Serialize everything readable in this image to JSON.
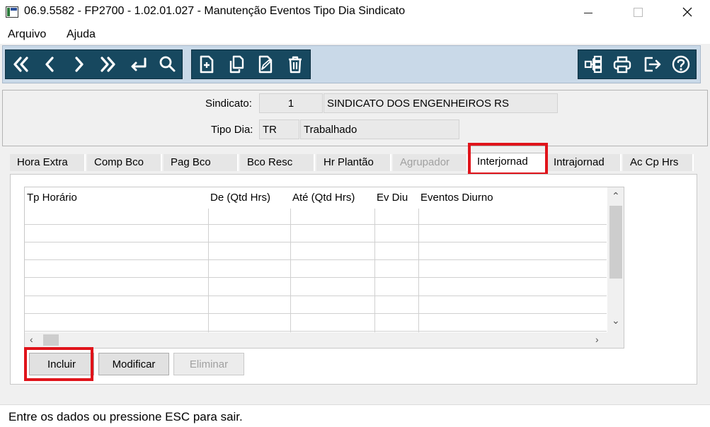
{
  "window": {
    "title": "06.9.5582 - FP2700 - 1.02.01.027 - Manutenção Eventos Tipo Dia Sindicato"
  },
  "menu": {
    "items": [
      "Arquivo",
      "Ajuda"
    ]
  },
  "toolbar": {
    "nav_icons": [
      "first-record-icon",
      "previous-record-icon",
      "next-record-icon",
      "last-record-icon",
      "enter-icon",
      "search-icon"
    ],
    "edit_icons": [
      "new-document-icon",
      "copy-document-icon",
      "edit-document-icon",
      "delete-icon"
    ],
    "right_icons": [
      "tree-structure-icon",
      "print-icon",
      "exit-icon",
      "help-icon"
    ],
    "color": "#17485f"
  },
  "header": {
    "sindicato_label": "Sindicato:",
    "sindicato_code": "1",
    "sindicato_name": "SINDICATO DOS ENGENHEIROS RS",
    "tipo_dia_label": "Tipo Dia:",
    "tipo_dia_code": "TR",
    "tipo_dia_name": "Trabalhado"
  },
  "tabs": [
    {
      "label": "Hora Extra",
      "state": "normal"
    },
    {
      "label": "Comp Bco",
      "state": "normal"
    },
    {
      "label": "Pag Bco",
      "state": "normal"
    },
    {
      "label": "Bco Resc",
      "state": "normal"
    },
    {
      "label": "Hr Plantão",
      "state": "normal"
    },
    {
      "label": "Agrupador",
      "state": "disabled"
    },
    {
      "label": "Interjornad",
      "state": "active"
    },
    {
      "label": "Intrajornad",
      "state": "normal"
    },
    {
      "label": "Ac Cp Hrs",
      "state": "normal"
    }
  ],
  "grid": {
    "columns": [
      "Tp Horário",
      "De (Qtd Hrs)",
      "Até (Qtd Hrs)",
      "Ev Diu",
      "Eventos Diurno"
    ],
    "rows": []
  },
  "buttons": {
    "incluir": "Incluir",
    "modificar": "Modificar",
    "eliminar": "Eliminar"
  },
  "status": {
    "text": "Entre os dados ou pressione ESC para sair."
  },
  "colors": {
    "highlight": "#e0141b"
  }
}
